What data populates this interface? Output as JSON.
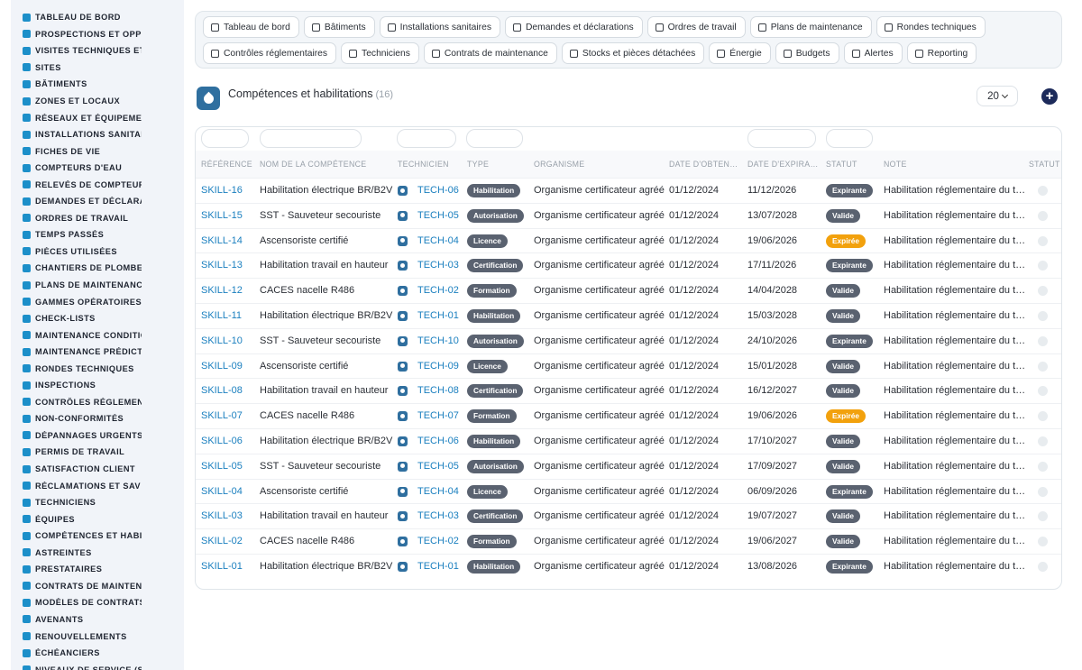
{
  "sidebar": {
    "items": [
      {
        "label": "TABLEAU DE BORD",
        "icon": "dashboard-icon"
      },
      {
        "label": "PROSPECTIONS ET OPPORTUNITÉS",
        "icon": "target-icon"
      },
      {
        "label": "VISITES TECHNIQUES ET AUDITS",
        "icon": "clipboard-icon"
      },
      {
        "label": "SITES",
        "icon": "map-pin-icon"
      },
      {
        "label": "BÂTIMENTS",
        "icon": "building-icon"
      },
      {
        "label": "ZONES ET LOCAUX",
        "icon": "layers-icon"
      },
      {
        "label": "RÉSEAUX ET ÉQUIPEMENTS",
        "icon": "network-icon"
      },
      {
        "label": "INSTALLATIONS SANITAIRES",
        "icon": "cogs-icon"
      },
      {
        "label": "FICHES DE VIE",
        "icon": "history-icon"
      },
      {
        "label": "COMPTEURS D'EAU",
        "icon": "gauge-icon"
      },
      {
        "label": "RELEVÉS DE COMPTEURS",
        "icon": "chart-icon"
      },
      {
        "label": "DEMANDES ET DÉCLARATIONS",
        "icon": "question-icon"
      },
      {
        "label": "ORDRES DE TRAVAIL",
        "icon": "clipboard-list-icon"
      },
      {
        "label": "TEMPS PASSÉS",
        "icon": "clock-icon"
      },
      {
        "label": "PIÈCES UTILISÉES",
        "icon": "box-icon"
      },
      {
        "label": "CHANTIERS DE PLOMBERIE",
        "icon": "wrench-icon"
      },
      {
        "label": "PLANS DE MAINTENANCE",
        "icon": "calendar-icon"
      },
      {
        "label": "GAMMES OPÉRATOIRES",
        "icon": "list-icon"
      },
      {
        "label": "CHECK-LISTS",
        "icon": "checklist-icon"
      },
      {
        "label": "MAINTENANCE CONDITIONNELLE",
        "icon": "thermometer-icon"
      },
      {
        "label": "MAINTENANCE PRÉDICTIVE",
        "icon": "trend-icon"
      },
      {
        "label": "RONDES TECHNIQUES",
        "icon": "route-icon"
      },
      {
        "label": "INSPECTIONS",
        "icon": "search-icon"
      },
      {
        "label": "CONTRÔLES RÉGLEMENTAIRES",
        "icon": "shield-icon"
      },
      {
        "label": "NON-CONFORMITÉS",
        "icon": "alert-circle-icon"
      },
      {
        "label": "DÉPANNAGES URGENTS",
        "icon": "warning-icon"
      },
      {
        "label": "PERMIS DE TRAVAIL",
        "icon": "file-icon"
      },
      {
        "label": "SATISFACTION CLIENT",
        "icon": "smile-icon"
      },
      {
        "label": "RÉCLAMATIONS ET SAV",
        "icon": "megaphone-icon"
      },
      {
        "label": "TECHNICIENS",
        "icon": "user-icon"
      },
      {
        "label": "ÉQUIPES",
        "icon": "users-icon"
      },
      {
        "label": "COMPÉTENCES ET HABILITATIONS",
        "icon": "certificate-icon"
      },
      {
        "label": "ASTREINTES",
        "icon": "phone-icon"
      },
      {
        "label": "PRESTATAIRES",
        "icon": "briefcase-icon"
      },
      {
        "label": "CONTRATS DE MAINTENANCE",
        "icon": "contract-icon"
      },
      {
        "label": "MODÈLES DE CONTRATS",
        "icon": "template-icon"
      },
      {
        "label": "AVENANTS",
        "icon": "edit-icon"
      },
      {
        "label": "RENOUVELLEMENTS",
        "icon": "refresh-icon"
      },
      {
        "label": "ÉCHÉANCIERS",
        "icon": "schedule-icon"
      },
      {
        "label": "NIVEAUX DE SERVICE (SLA)",
        "icon": "level-icon"
      }
    ]
  },
  "toolbar": {
    "row1": [
      {
        "label": "Tableau de bord",
        "icon": "dashboard-icon"
      },
      {
        "label": "Bâtiments",
        "icon": "building-icon"
      },
      {
        "label": "Installations sanitaires",
        "icon": "cogs-icon"
      },
      {
        "label": "Demandes et déclarations",
        "icon": "question-icon"
      },
      {
        "label": "Ordres de travail",
        "icon": "clipboard-icon"
      },
      {
        "label": "Plans de maintenance",
        "icon": "calendar-icon"
      },
      {
        "label": "Rondes techniques",
        "icon": "route-icon"
      }
    ],
    "row2": [
      {
        "label": "Contrôles réglementaires",
        "icon": "clipboard-check-icon"
      },
      {
        "label": "Techniciens",
        "icon": "hard-hat-icon"
      },
      {
        "label": "Contrats de maintenance",
        "icon": "file-icon"
      },
      {
        "label": "Stocks et pièces détachées",
        "icon": "boxes-icon"
      },
      {
        "label": "Énergie",
        "icon": "bolt-icon"
      },
      {
        "label": "Budgets",
        "icon": "money-icon"
      },
      {
        "label": "Alertes",
        "icon": "bell-icon"
      },
      {
        "label": "Reporting",
        "icon": "pie-chart-icon"
      }
    ]
  },
  "header": {
    "title": "Compétences et habilitations",
    "count": "(16)",
    "page_size": "20"
  },
  "table": {
    "columns": [
      "RÉFÉRENCE",
      "NOM DE LA COMPÉTENCE",
      "TECHNICIEN",
      "TYPE",
      "ORGANISME",
      "DATE D'OBTEN…",
      "DATE D'EXPIRA…",
      "STATUT",
      "NOTE",
      "STATUT"
    ],
    "rows": [
      {
        "ref": "SKILL-16",
        "name": "Habilitation électrique BR/B2V",
        "tech": "TECH-06",
        "type": "Habilitation",
        "org": "Organisme certificateur agréé",
        "obt": "01/12/2024",
        "exp": "11/12/2026",
        "status": "Expirante",
        "note": "Habilitation réglementaire du t…"
      },
      {
        "ref": "SKILL-15",
        "name": "SST - Sauveteur secouriste",
        "tech": "TECH-05",
        "type": "Autorisation",
        "org": "Organisme certificateur agréé",
        "obt": "01/12/2024",
        "exp": "13/07/2028",
        "status": "Valide",
        "note": "Habilitation réglementaire du t…"
      },
      {
        "ref": "SKILL-14",
        "name": "Ascensoriste certifié",
        "tech": "TECH-04",
        "type": "Licence",
        "org": "Organisme certificateur agréé",
        "obt": "01/12/2024",
        "exp": "19/06/2026",
        "status": "Expirée",
        "note": "Habilitation réglementaire du t…"
      },
      {
        "ref": "SKILL-13",
        "name": "Habilitation travail en hauteur",
        "tech": "TECH-03",
        "type": "Certification",
        "org": "Organisme certificateur agréé",
        "obt": "01/12/2024",
        "exp": "17/11/2026",
        "status": "Expirante",
        "note": "Habilitation réglementaire du t…"
      },
      {
        "ref": "SKILL-12",
        "name": "CACES nacelle R486",
        "tech": "TECH-02",
        "type": "Formation",
        "org": "Organisme certificateur agréé",
        "obt": "01/12/2024",
        "exp": "14/04/2028",
        "status": "Valide",
        "note": "Habilitation réglementaire du t…"
      },
      {
        "ref": "SKILL-11",
        "name": "Habilitation électrique BR/B2V",
        "tech": "TECH-01",
        "type": "Habilitation",
        "org": "Organisme certificateur agréé",
        "obt": "01/12/2024",
        "exp": "15/03/2028",
        "status": "Valide",
        "note": "Habilitation réglementaire du t…"
      },
      {
        "ref": "SKILL-10",
        "name": "SST - Sauveteur secouriste",
        "tech": "TECH-10",
        "type": "Autorisation",
        "org": "Organisme certificateur agréé",
        "obt": "01/12/2024",
        "exp": "24/10/2026",
        "status": "Expirante",
        "note": "Habilitation réglementaire du t…"
      },
      {
        "ref": "SKILL-09",
        "name": "Ascensoriste certifié",
        "tech": "TECH-09",
        "type": "Licence",
        "org": "Organisme certificateur agréé",
        "obt": "01/12/2024",
        "exp": "15/01/2028",
        "status": "Valide",
        "note": "Habilitation réglementaire du t…"
      },
      {
        "ref": "SKILL-08",
        "name": "Habilitation travail en hauteur",
        "tech": "TECH-08",
        "type": "Certification",
        "org": "Organisme certificateur agréé",
        "obt": "01/12/2024",
        "exp": "16/12/2027",
        "status": "Valide",
        "note": "Habilitation réglementaire du t…"
      },
      {
        "ref": "SKILL-07",
        "name": "CACES nacelle R486",
        "tech": "TECH-07",
        "type": "Formation",
        "org": "Organisme certificateur agréé",
        "obt": "01/12/2024",
        "exp": "19/06/2026",
        "status": "Expirée",
        "note": "Habilitation réglementaire du t…"
      },
      {
        "ref": "SKILL-06",
        "name": "Habilitation électrique BR/B2V",
        "tech": "TECH-06",
        "type": "Habilitation",
        "org": "Organisme certificateur agréé",
        "obt": "01/12/2024",
        "exp": "17/10/2027",
        "status": "Valide",
        "note": "Habilitation réglementaire du t…"
      },
      {
        "ref": "SKILL-05",
        "name": "SST - Sauveteur secouriste",
        "tech": "TECH-05",
        "type": "Autorisation",
        "org": "Organisme certificateur agréé",
        "obt": "01/12/2024",
        "exp": "17/09/2027",
        "status": "Valide",
        "note": "Habilitation réglementaire du t…"
      },
      {
        "ref": "SKILL-04",
        "name": "Ascensoriste certifié",
        "tech": "TECH-04",
        "type": "Licence",
        "org": "Organisme certificateur agréé",
        "obt": "01/12/2024",
        "exp": "06/09/2026",
        "status": "Expirante",
        "note": "Habilitation réglementaire du t…"
      },
      {
        "ref": "SKILL-03",
        "name": "Habilitation travail en hauteur",
        "tech": "TECH-03",
        "type": "Certification",
        "org": "Organisme certificateur agréé",
        "obt": "01/12/2024",
        "exp": "19/07/2027",
        "status": "Valide",
        "note": "Habilitation réglementaire du t…"
      },
      {
        "ref": "SKILL-02",
        "name": "CACES nacelle R486",
        "tech": "TECH-02",
        "type": "Formation",
        "org": "Organisme certificateur agréé",
        "obt": "01/12/2024",
        "exp": "19/06/2027",
        "status": "Valide",
        "note": "Habilitation réglementaire du t…"
      },
      {
        "ref": "SKILL-01",
        "name": "Habilitation électrique BR/B2V",
        "tech": "TECH-01",
        "type": "Habilitation",
        "org": "Organisme certificateur agréé",
        "obt": "01/12/2024",
        "exp": "13/08/2026",
        "status": "Expirante",
        "note": "Habilitation réglementaire du t…"
      }
    ]
  },
  "colors": {
    "link": "#1a7fbf",
    "badge_default": "#5a6270",
    "badge_expired": "#f2a10d",
    "sidebar_icon": "#1c8fc9",
    "add_button": "#1c2a5a"
  }
}
